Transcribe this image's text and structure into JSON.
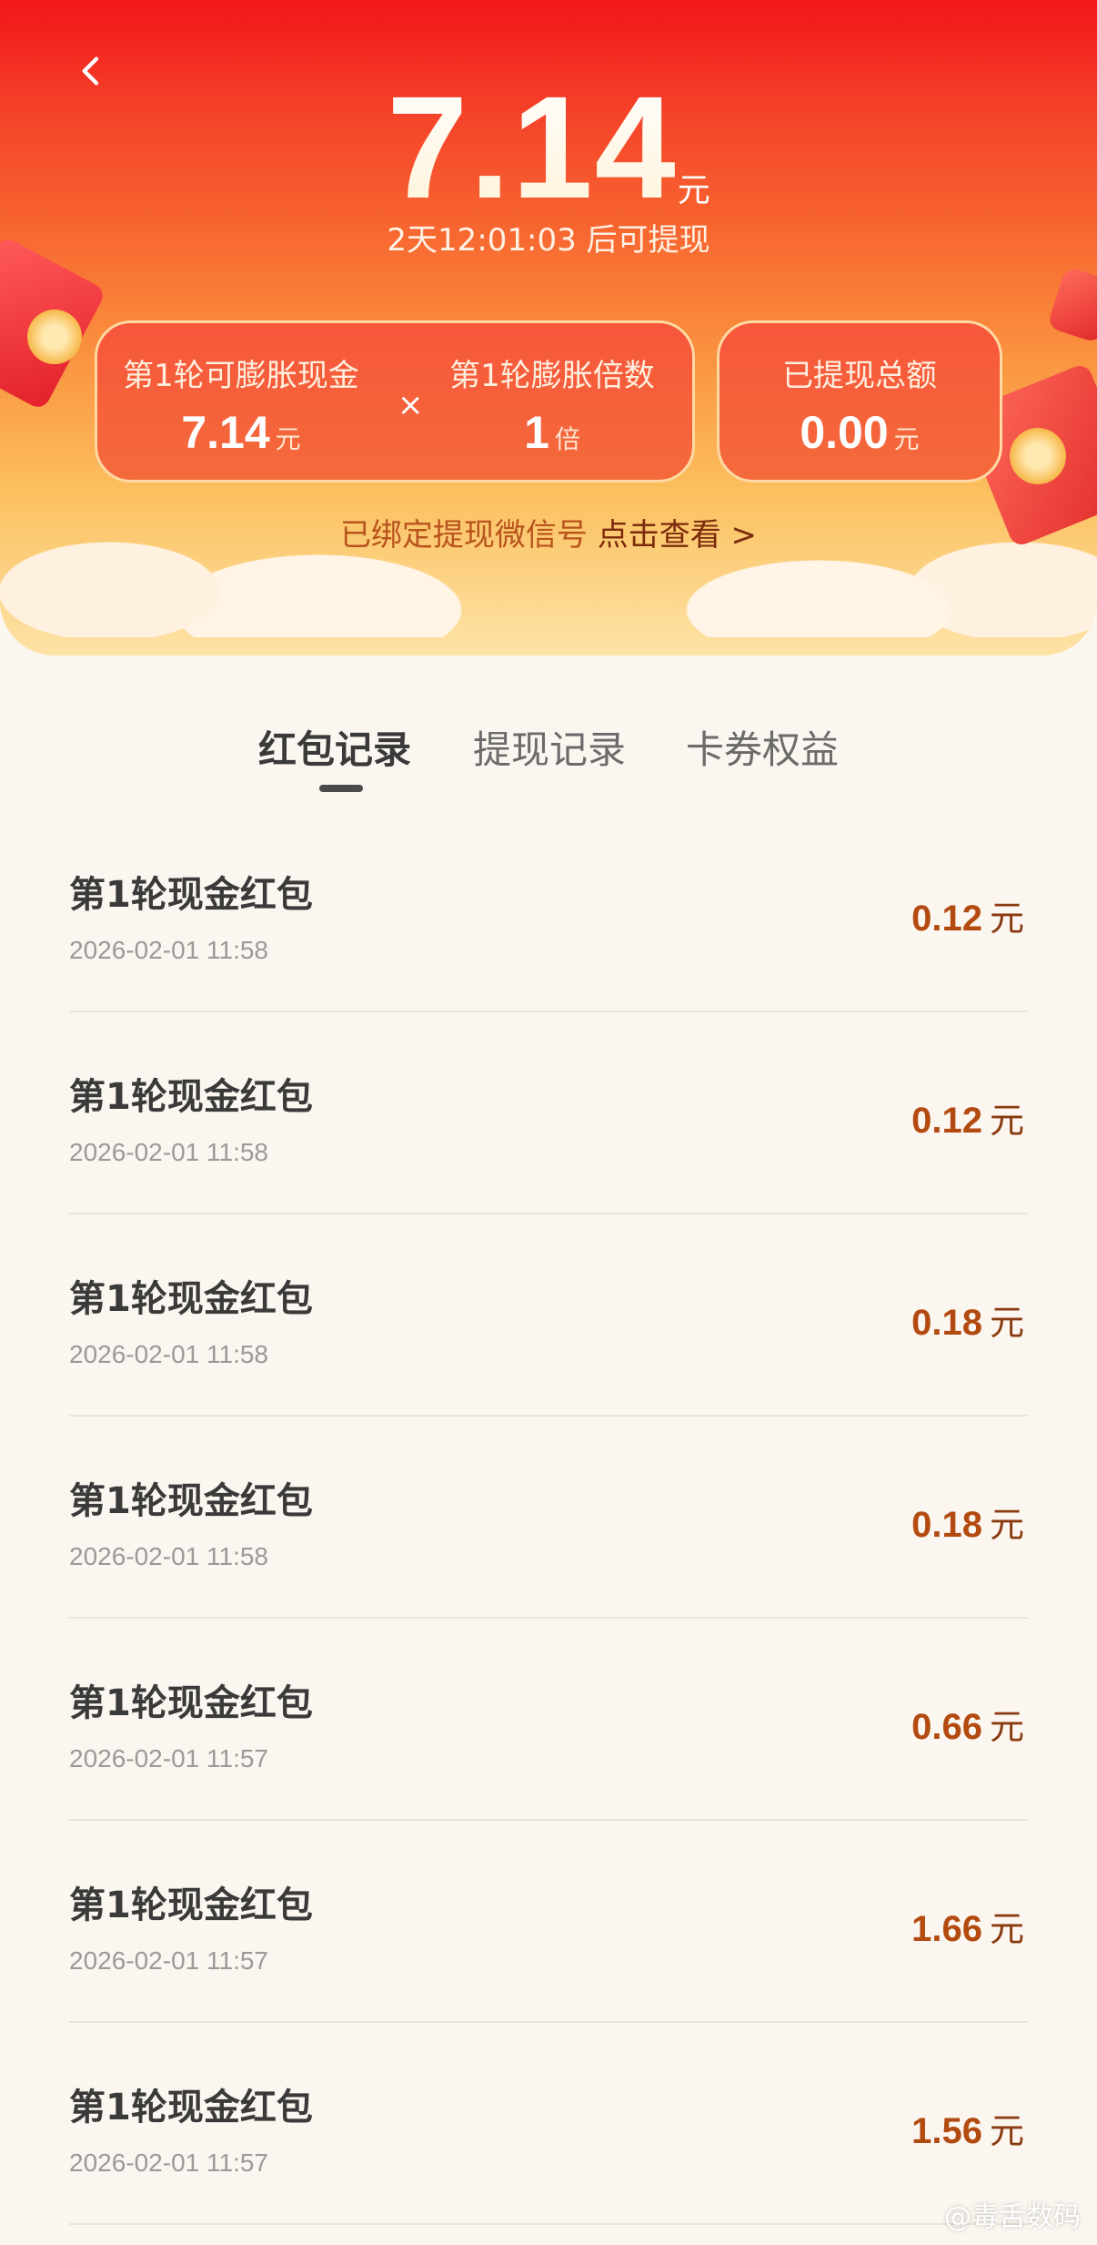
{
  "header": {
    "amount": "7.14",
    "amount_unit": "元",
    "countdown": "2天12:01:03 后可提现",
    "inflate_card": {
      "cash_label": "第1轮可膨胀现金",
      "cash_value": "7.14",
      "cash_unit": "元",
      "times_symbol": "×",
      "multiplier_label": "第1轮膨胀倍数",
      "multiplier_value": "1",
      "multiplier_unit": "倍"
    },
    "withdrawn_card": {
      "label": "已提现总额",
      "value": "0.00",
      "unit": "元"
    },
    "wechat_text": "已绑定提现微信号",
    "wechat_link": "点击查看 >"
  },
  "tabs": [
    {
      "label": "红包记录"
    },
    {
      "label": "提现记录"
    },
    {
      "label": "卡券权益"
    }
  ],
  "records": [
    {
      "title": "第1轮现金红包",
      "time": "2026-02-01 11:58",
      "amount": "0.12",
      "unit": "元"
    },
    {
      "title": "第1轮现金红包",
      "time": "2026-02-01 11:58",
      "amount": "0.12",
      "unit": "元"
    },
    {
      "title": "第1轮现金红包",
      "time": "2026-02-01 11:58",
      "amount": "0.18",
      "unit": "元"
    },
    {
      "title": "第1轮现金红包",
      "time": "2026-02-01 11:58",
      "amount": "0.18",
      "unit": "元"
    },
    {
      "title": "第1轮现金红包",
      "time": "2026-02-01 11:57",
      "amount": "0.66",
      "unit": "元"
    },
    {
      "title": "第1轮现金红包",
      "time": "2026-02-01 11:57",
      "amount": "1.66",
      "unit": "元"
    },
    {
      "title": "第1轮现金红包",
      "time": "2026-02-01 11:57",
      "amount": "1.56",
      "unit": "元"
    }
  ],
  "watermark": "@毒舌数码",
  "icons": {
    "back": "chevron-left-icon"
  }
}
